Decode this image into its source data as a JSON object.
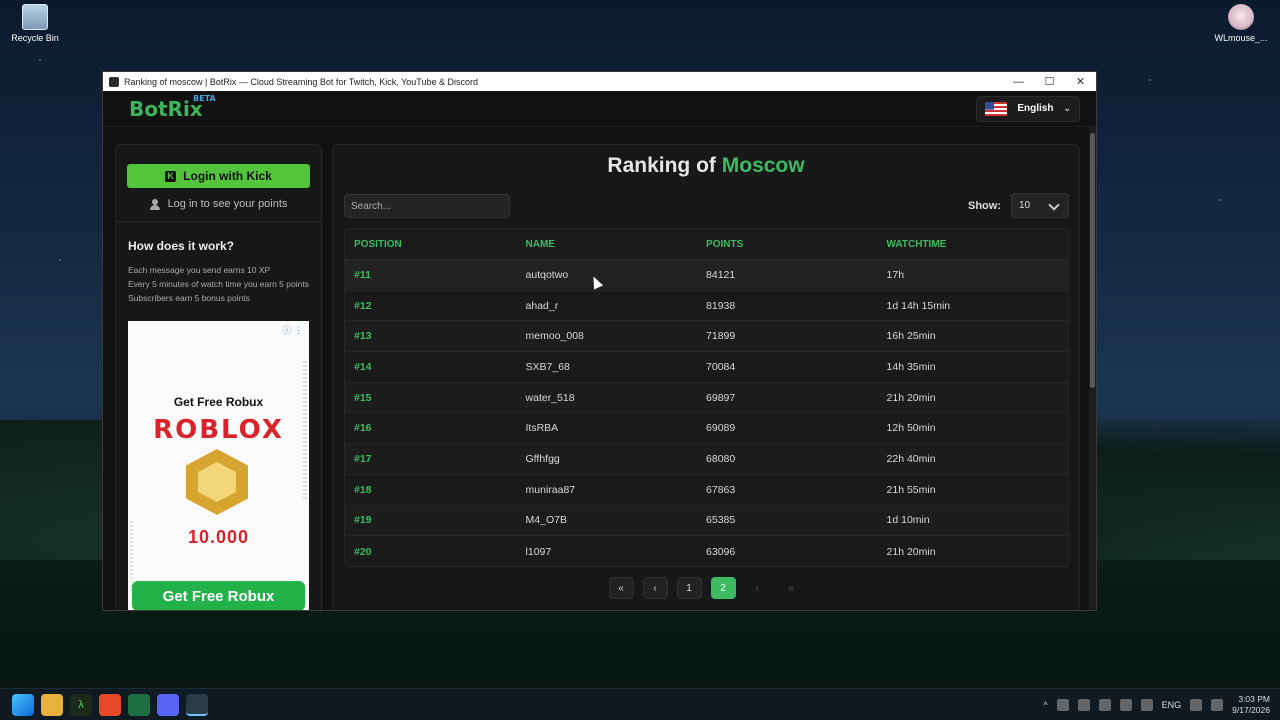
{
  "desktop": {
    "icons": [
      {
        "label": "Recycle Bin"
      },
      {
        "label": "WLmouse_..."
      }
    ]
  },
  "window": {
    "title": "Ranking of moscow | BotRix — Cloud Streaming Bot for Twitch, Kick, YouTube & Discord",
    "controls": {
      "minimize": "—",
      "maximize": "☐",
      "close": "✕"
    }
  },
  "header": {
    "logo": "BotRix",
    "logo_badge": "BETA",
    "language": "English",
    "language_chevron": "⌄"
  },
  "sidebar": {
    "login_label": "Login with Kick",
    "login_icon": "K",
    "points_hint": "Log in to see your points",
    "how_title": "How does it work?",
    "how_lines": [
      "Each message you send earns 10 XP",
      "Every 5 minutes of watch time you earn 5 points",
      "Subscribers earn 5 bonus points"
    ],
    "ad": {
      "info": "ⓘ ⋮",
      "headline": "Get Free Robux",
      "brand": "ROBLOX",
      "amount": "10.000",
      "cta": "Get Free Robux"
    }
  },
  "ranking": {
    "title_prefix": "Ranking of",
    "city": "Moscow",
    "search_placeholder": "Search...",
    "show_label": "Show:",
    "show_value": "10",
    "columns": [
      "POSITION",
      "NAME",
      "POINTS",
      "WATCHTIME"
    ],
    "rows": [
      {
        "position": "#11",
        "name": "autqotwo",
        "points": "84121",
        "watchtime": "17h"
      },
      {
        "position": "#12",
        "name": "ahad_r",
        "points": "81938",
        "watchtime": "1d 14h 15min"
      },
      {
        "position": "#13",
        "name": "memoo_008",
        "points": "71899",
        "watchtime": "16h 25min"
      },
      {
        "position": "#14",
        "name": "SXB7_68",
        "points": "70084",
        "watchtime": "14h 35min"
      },
      {
        "position": "#15",
        "name": "water_518",
        "points": "69897",
        "watchtime": "21h 20min"
      },
      {
        "position": "#16",
        "name": "ItsRBA",
        "points": "69089",
        "watchtime": "12h 50min"
      },
      {
        "position": "#17",
        "name": "Gffhfgg",
        "points": "68080",
        "watchtime": "22h 40min"
      },
      {
        "position": "#18",
        "name": "muniraa87",
        "points": "67863",
        "watchtime": "21h 55min"
      },
      {
        "position": "#19",
        "name": "M4_O7B",
        "points": "65385",
        "watchtime": "1d 10min"
      },
      {
        "position": "#20",
        "name": "l1097",
        "points": "63096",
        "watchtime": "21h 20min"
      }
    ],
    "pagination": {
      "first": "«",
      "prev": "‹",
      "pages": [
        "1",
        "2"
      ],
      "active_page": "2",
      "next": "›",
      "last": "»"
    }
  },
  "taskbar": {
    "tray_lang": "ENG",
    "time": "3:03 PM",
    "date": "9/17/2026",
    "tray_up": "^"
  }
}
